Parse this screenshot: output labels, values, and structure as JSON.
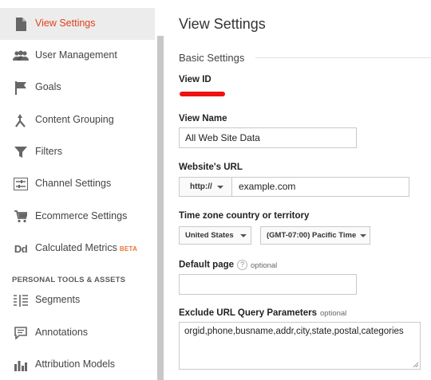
{
  "sidebar": {
    "items": [
      {
        "label": "View Settings",
        "icon": "document-icon",
        "active": true
      },
      {
        "label": "User Management",
        "icon": "users-icon"
      },
      {
        "label": "Goals",
        "icon": "flag-icon"
      },
      {
        "label": "Content Grouping",
        "icon": "content-grouping-icon"
      },
      {
        "label": "Filters",
        "icon": "filter-icon"
      },
      {
        "label": "Channel Settings",
        "icon": "channel-settings-icon"
      },
      {
        "label": "Ecommerce Settings",
        "icon": "cart-icon"
      },
      {
        "label": "Calculated Metrics",
        "icon": "dd-icon",
        "badge": "BETA",
        "icon_text": "Dd"
      }
    ],
    "section_heading": "PERSONAL TOOLS & ASSETS",
    "personal_items": [
      {
        "label": "Segments",
        "icon": "segments-icon"
      },
      {
        "label": "Annotations",
        "icon": "annotation-icon"
      },
      {
        "label": "Attribution Models",
        "icon": "bar-chart-icon"
      }
    ]
  },
  "main": {
    "title": "View Settings",
    "section_title": "Basic Settings",
    "view_id": {
      "label": "View ID"
    },
    "view_name": {
      "label": "View Name",
      "value": "All Web Site Data"
    },
    "website_url": {
      "label": "Website's URL",
      "protocol": "http://",
      "value": "example.com"
    },
    "timezone": {
      "label": "Time zone country or territory",
      "country": "United States",
      "zone": "(GMT-07:00) Pacific Time"
    },
    "default_page": {
      "label": "Default page",
      "help": "?",
      "optional": "optional",
      "value": ""
    },
    "exclude_params": {
      "label": "Exclude URL Query Parameters",
      "optional": "optional",
      "value": "orgid,phone,busname,addr,city,state,postal,categories"
    }
  },
  "colors": {
    "accent": "#e0401c",
    "redaction": "#ee1111",
    "beta": "#e8772e",
    "active_bg": "#ececec"
  }
}
